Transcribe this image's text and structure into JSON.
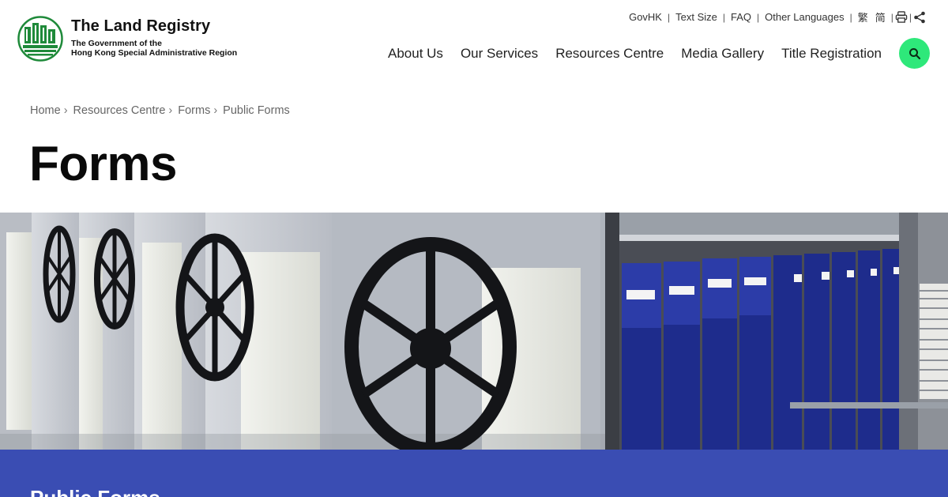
{
  "brand": {
    "title": "The Land Registry",
    "subtitle_line1": "The Government of the",
    "subtitle_line2": "Hong Kong Special Administrative Region",
    "color": "#1f8a3a"
  },
  "utility_nav": {
    "items": [
      "GovHK",
      "Text Size",
      "FAQ",
      "Other Languages",
      "繁",
      "简"
    ],
    "icons": [
      "printer-icon",
      "share-icon"
    ]
  },
  "main_nav": {
    "items": [
      "About Us",
      "Our Services",
      "Resources Centre",
      "Media Gallery",
      "Title Registration"
    ]
  },
  "search": {
    "icon": "search-icon",
    "color": "#2ee87a"
  },
  "breadcrumb": [
    "Home",
    "Resources Centre",
    "Forms",
    "Public Forms"
  ],
  "page_title": "Forms",
  "hero": {
    "description_icon": "archive-shelves-image"
  },
  "section": {
    "title": "Public Forms",
    "band_color": "#3a4db3"
  }
}
